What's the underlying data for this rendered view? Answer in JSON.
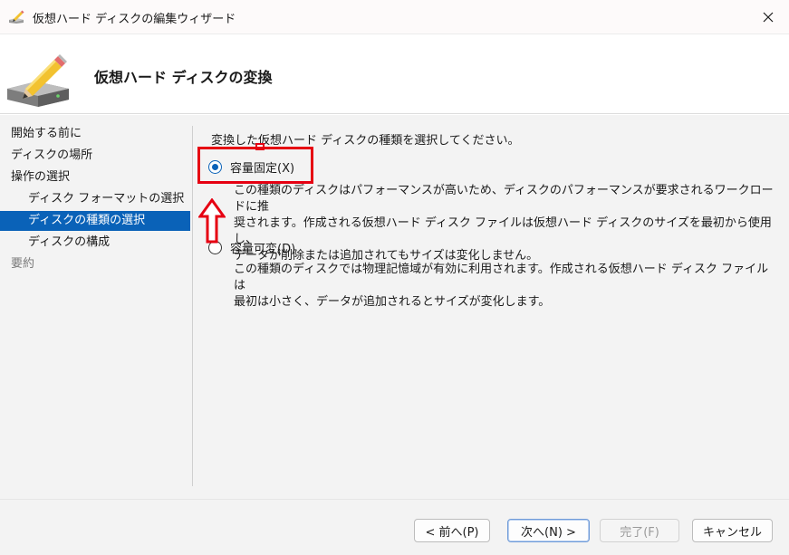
{
  "window": {
    "title": "仮想ハード ディスクの編集ウィザード"
  },
  "icons": {
    "app": "disk-pencil-icon",
    "close": "close-icon",
    "header": "disk-pencil-icon"
  },
  "colors": {
    "accent": "#0a62b8",
    "annotation": "#e60012"
  },
  "header": {
    "title": "仮想ハード ディスクの変換"
  },
  "nav": {
    "items": [
      {
        "label": "開始する前に"
      },
      {
        "label": "ディスクの場所"
      },
      {
        "label": "操作の選択"
      },
      {
        "label": "ディスク フォーマットの選択"
      },
      {
        "label": "ディスクの種類の選択",
        "selected": true
      },
      {
        "label": "ディスクの構成"
      },
      {
        "label": "要約",
        "disabled": true
      }
    ]
  },
  "content": {
    "instruction": "変換した仮想ハード ディスクの種類を選択してください。",
    "options": [
      {
        "label": "容量固定(X)",
        "checked": true,
        "description_lines": [
          "この種類のディスクはパフォーマンスが高いため、ディスクのパフォーマンスが要求されるワークロードに推",
          "奨されます。作成される仮想ハード ディスク ファイルは仮想ハード ディスクのサイズを最初から使用し、",
          "データが削除または追加されてもサイズは変化しません。"
        ]
      },
      {
        "label": "容量可変(D)",
        "checked": false,
        "description_lines": [
          "この種類のディスクでは物理記憶域が有効に利用されます。作成される仮想ハード ディスク ファイルは",
          "最初は小さく、データが追加されるとサイズが変化します。"
        ]
      }
    ]
  },
  "footer": {
    "back": "< 前へ(P)",
    "next": "次へ(N) >",
    "finish": "完了(F)",
    "cancel": "キャンセル"
  }
}
